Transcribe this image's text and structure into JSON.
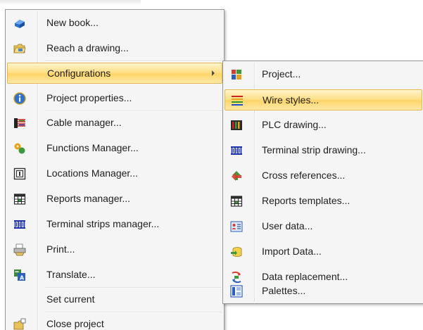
{
  "main_menu": {
    "items": [
      {
        "label": "New book...",
        "icon": "new-book-icon"
      },
      {
        "label": "Reach a drawing...",
        "icon": "folder-open-icon"
      },
      {
        "label": "Configurations",
        "icon": "",
        "has_submenu": true,
        "highlighted": true
      },
      {
        "label": "Project properties...",
        "icon": "info-icon"
      },
      {
        "label": "Cable manager...",
        "icon": "cable-icon"
      },
      {
        "label": "Functions Manager...",
        "icon": "functions-icon"
      },
      {
        "label": "Locations Manager...",
        "icon": "locations-icon"
      },
      {
        "label": "Reports manager...",
        "icon": "reports-icon"
      },
      {
        "label": "Terminal strips manager...",
        "icon": "terminal-strip-icon"
      },
      {
        "label": "Print...",
        "icon": "print-icon"
      },
      {
        "label": "Translate...",
        "icon": "translate-icon"
      },
      {
        "label": "Set current",
        "icon": ""
      },
      {
        "label": "Close project",
        "icon": "close-project-icon"
      }
    ]
  },
  "submenu": {
    "items": [
      {
        "label": "Project...",
        "icon": "project-icon"
      },
      {
        "label": "Wire styles...",
        "icon": "wire-styles-icon",
        "highlighted": true
      },
      {
        "label": "PLC drawing...",
        "icon": "plc-icon"
      },
      {
        "label": "Terminal strip drawing...",
        "icon": "terminal-strip-icon"
      },
      {
        "label": "Cross references...",
        "icon": "cross-references-icon"
      },
      {
        "label": "Reports templates...",
        "icon": "reports-icon"
      },
      {
        "label": "User data...",
        "icon": "user-data-icon"
      },
      {
        "label": "Import Data...",
        "icon": "import-data-icon"
      },
      {
        "label": "Data replacement...",
        "icon": "data-replacement-icon"
      },
      {
        "label": "Palettes...",
        "icon": "palettes-icon"
      }
    ]
  },
  "colors": {
    "menu_bg": "#f5f5f5",
    "highlight_top": "#fff4cc",
    "highlight_bottom": "#ffd56a",
    "highlight_border": "#e5b750"
  }
}
